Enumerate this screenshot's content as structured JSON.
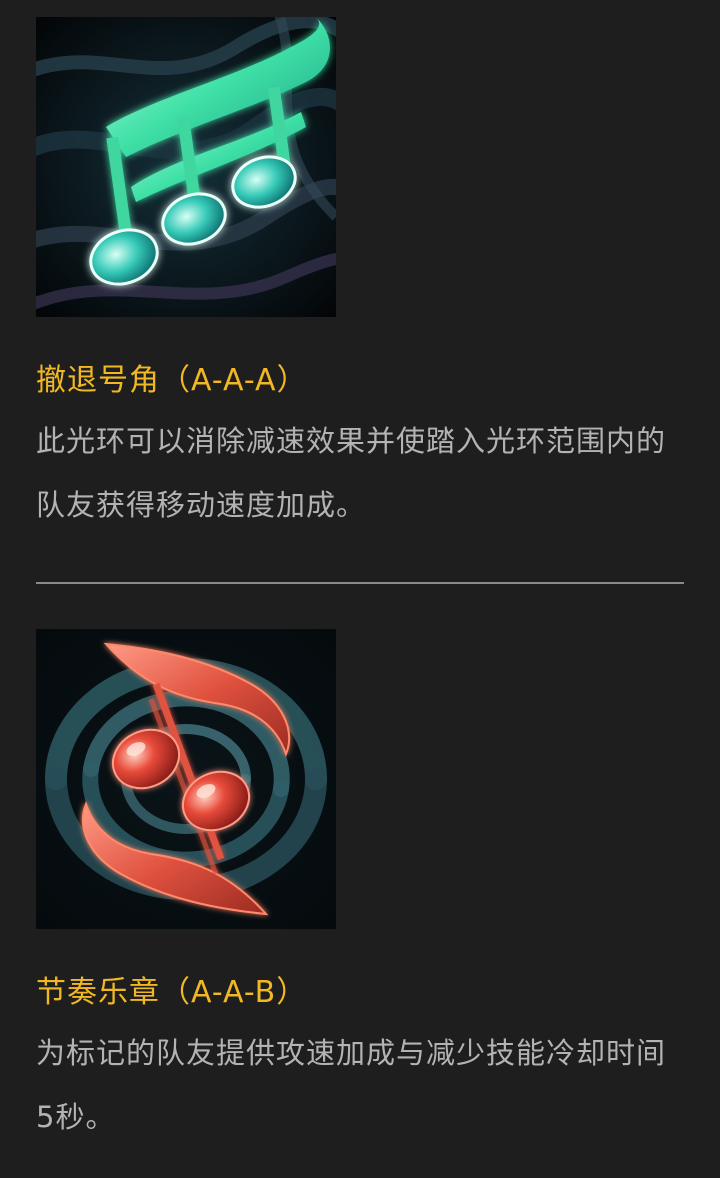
{
  "skills": [
    {
      "icon": "teal-music-notes-icon",
      "title": "撤退号角（A-A-A）",
      "description": "此光环可以消除减速效果并使踏入光环范围内的队友获得移动速度加成。"
    },
    {
      "icon": "red-music-note-swirl-icon",
      "title": "节奏乐章（A-A-B）",
      "description": "为标记的队友提供攻速加成与减少技能冷却时间5秒。"
    }
  ],
  "colors": {
    "background": "#1e1e1e",
    "title": "#f2b824",
    "description": "#b3b3b3",
    "divider": "#8a8a8a"
  }
}
